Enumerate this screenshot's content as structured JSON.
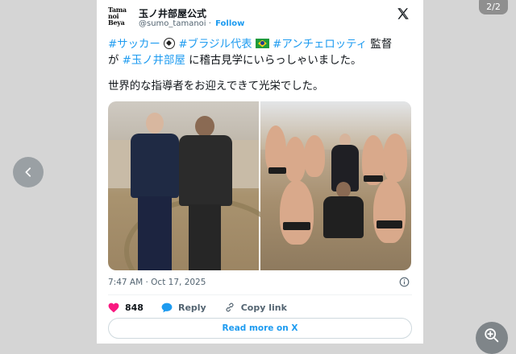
{
  "viewer": {
    "counter": "2/2"
  },
  "post": {
    "account": {
      "name": "玉ノ井部屋公式",
      "handle": "@sumo_tamanoi",
      "separator": "·",
      "follow_label": "Follow",
      "logo_text": [
        "Tama",
        "noi",
        "Beya"
      ]
    },
    "text": {
      "line1_tag1": "#サッカー",
      "line1_tag2": "#ブラジル代表",
      "line1_tag3": "#アンチェロッティ",
      "line1_rest": " 監督",
      "line2_a": "が ",
      "line2_tag": "#玉ノ井部屋",
      "line2_rest": " に稽古見学にいらっしゃいました。",
      "line3": "世界的な指導者をお迎えできて光栄でした。"
    },
    "timestamp": "7:47 AM · Oct 17, 2025",
    "actions": {
      "likes": "848",
      "reply_label": "Reply",
      "copy_label": "Copy link"
    },
    "read_more_label": "Read more on X"
  },
  "icons": {
    "x_logo": "x-logo-icon",
    "soccer": "soccer-ball-icon",
    "flag": "brazil-flag-icon",
    "info": "info-icon",
    "heart": "heart-icon",
    "reply": "reply-bubble-icon",
    "link": "link-icon",
    "prev": "chevron-left-icon",
    "zoom": "zoom-in-icon"
  },
  "colors": {
    "accent": "#1d9bf0",
    "heart": "#f91880",
    "text": "#0f1419",
    "muted": "#536471"
  }
}
